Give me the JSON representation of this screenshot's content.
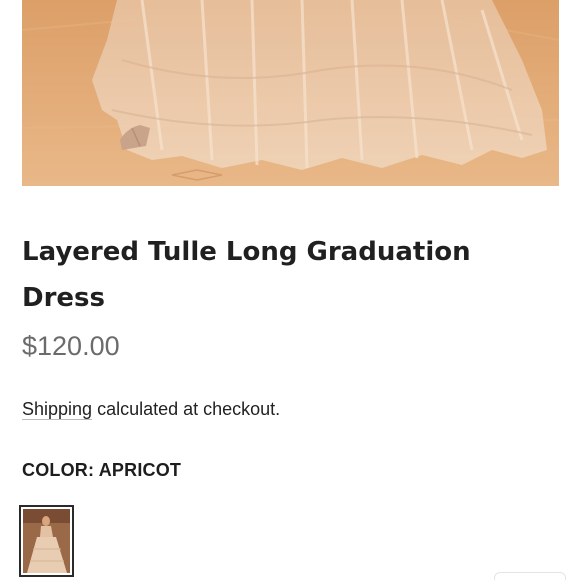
{
  "product": {
    "title": "Layered Tulle Long Graduation Dress",
    "price": "$120.00",
    "shipping_link": "Shipping",
    "shipping_rest": " calculated at checkout.",
    "color_label": "COLOR: APRICOT",
    "swatch_name": "Apricot"
  },
  "colors": {
    "background": "#ffffff",
    "title": "#202020",
    "price": "#6b6b6b",
    "hero_warm": "#d9a06a",
    "swatch_border": "#2a2a2a"
  },
  "icons": {
    "hero": "product-photo",
    "swatch": "color-swatch-thumbnail"
  }
}
